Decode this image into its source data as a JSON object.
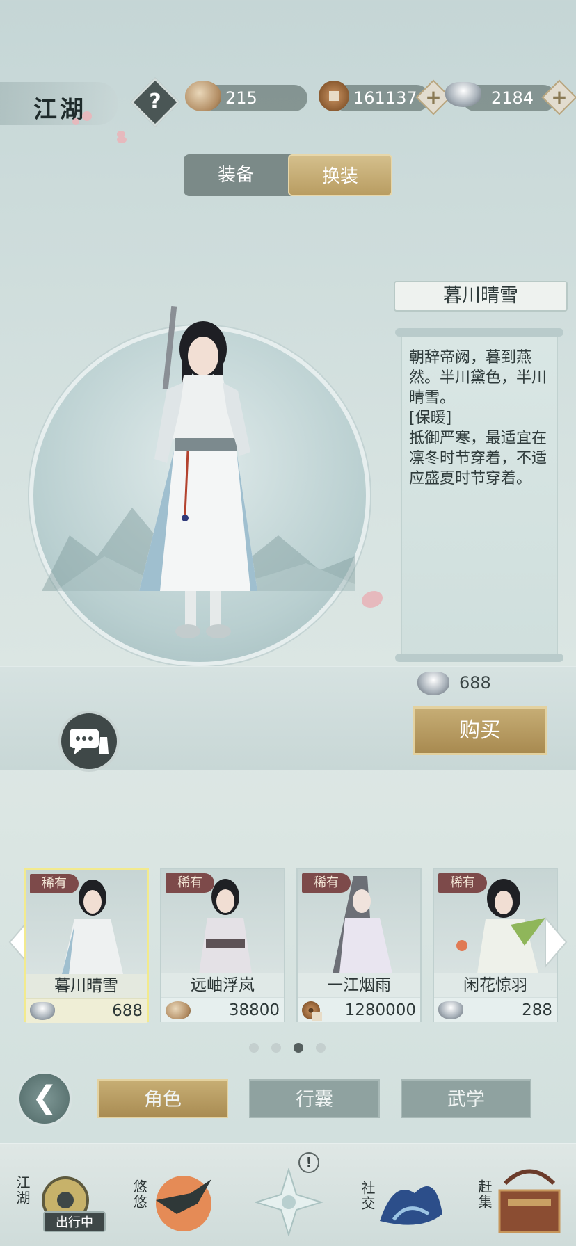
{
  "header": {
    "area_label": "江湖",
    "help_label": "?",
    "shells": "215",
    "copper": "161137",
    "silver": "2184",
    "plus_label": "+"
  },
  "segment_tabs": [
    {
      "label": "装备",
      "active": false
    },
    {
      "label": "换装",
      "active": true
    }
  ],
  "outfit": {
    "name": "暮川晴雪",
    "description": "朝辞帝阙，暮到燕然。半川黛色，半川晴雪。",
    "trait": "[保暖]",
    "trait_desc": "抵御严寒，最适宜在凛冬时节穿着，不适应盛夏时节穿着。",
    "price": "688",
    "price_currency_icon": "silver-ingot-icon",
    "buy_label": "购买"
  },
  "cards": [
    {
      "rarity": "稀有",
      "name": "暮川晴雪",
      "price": "688",
      "currency": "silver",
      "selected": true
    },
    {
      "rarity": "稀有",
      "name": "远岫浮岚",
      "price": "38800",
      "currency": "shell",
      "selected": false
    },
    {
      "rarity": "稀有",
      "name": "一江烟雨",
      "price": "1280000",
      "currency": "copper",
      "selected": false
    },
    {
      "rarity": "稀有",
      "name": "闲花惊羽",
      "price": "288",
      "currency": "silver",
      "selected": false
    }
  ],
  "pagination": {
    "count": 4,
    "active_index": 2
  },
  "main_tabs": [
    {
      "label": "角色",
      "active": true
    },
    {
      "label": "行囊",
      "active": false
    },
    {
      "label": "武学",
      "active": false
    }
  ],
  "navbar": {
    "items": [
      {
        "label": "江湖",
        "badge": "出行中"
      },
      {
        "label": "悠悠"
      },
      {
        "label": ""
      },
      {
        "label": "社交"
      },
      {
        "label": "赶集"
      }
    ],
    "notice_mark": "!"
  },
  "colors": {
    "gold_button": "#b99d62",
    "rarity_tag": "#7d4a4a",
    "background": "#d7e3e1"
  }
}
